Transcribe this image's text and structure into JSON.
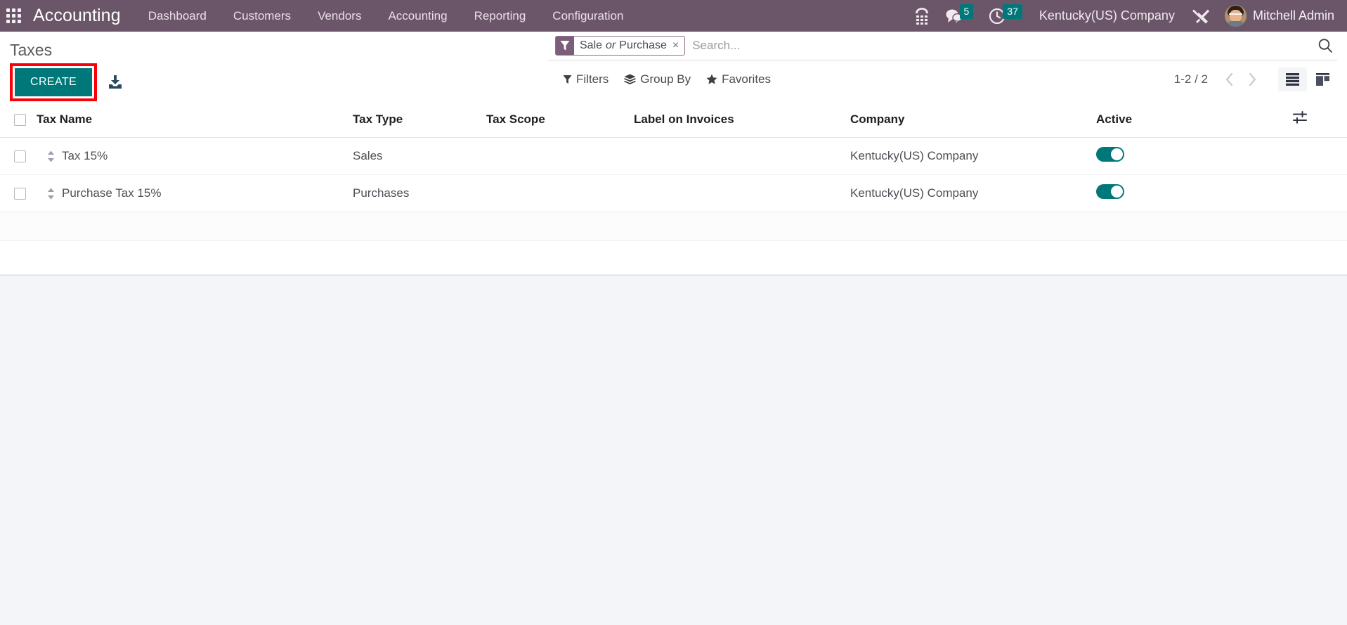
{
  "navbar": {
    "apps_icon": "apps-grid-icon",
    "brand": "Accounting",
    "menu": [
      {
        "label": "Dashboard"
      },
      {
        "label": "Customers"
      },
      {
        "label": "Vendors"
      },
      {
        "label": "Accounting"
      },
      {
        "label": "Reporting"
      },
      {
        "label": "Configuration"
      }
    ],
    "voip_icon": "phone-keypad-icon",
    "messages_icon": "chat-bubble-icon",
    "messages_count": "5",
    "activities_icon": "clock-icon",
    "activities_count": "37",
    "company": "Kentucky(US) Company",
    "tools_icon": "wrench-screwdriver-icon",
    "avatar_icon": "user-avatar",
    "user": "Mitchell Admin",
    "colors": {
      "navbar_bg": "#6b5569",
      "badge_bg": "#00787a"
    }
  },
  "control_panel": {
    "title": "Taxes",
    "create_label": "CREATE",
    "create_color": "#00787a",
    "highlight_color": "#fb0007",
    "import_icon": "import-download-icon",
    "search": {
      "facet_icon": "filter-funnel-icon",
      "facet_part1": "Sale",
      "facet_conj": "or",
      "facet_part2": "Purchase",
      "facet_remove": "×",
      "placeholder": "Search...",
      "value": "",
      "magnifier_icon": "search-icon"
    },
    "tools": [
      {
        "icon": "filter-funnel-icon",
        "label": "Filters"
      },
      {
        "icon": "layers-icon",
        "label": "Group By"
      },
      {
        "icon": "star-icon",
        "label": "Favorites"
      }
    ],
    "pager": {
      "count": "1-2 / 2",
      "prev_icon": "chevron-left-icon",
      "next_icon": "chevron-right-icon"
    },
    "views": [
      {
        "icon": "list-view-icon",
        "active": true
      },
      {
        "icon": "kanban-view-icon",
        "active": false
      }
    ]
  },
  "table": {
    "columns": [
      "Tax Name",
      "Tax Type",
      "Tax Scope",
      "Label on Invoices",
      "Company",
      "Active"
    ],
    "options_icon": "column-options-icon",
    "select_all_icon": "checkbox",
    "rows": [
      {
        "handle_icon": "drag-handle-icon",
        "name": "Tax 15%",
        "type": "Sales",
        "scope": "",
        "label_on_invoices": "",
        "company": "Kentucky(US) Company",
        "active": true
      },
      {
        "handle_icon": "drag-handle-icon",
        "name": "Purchase Tax 15%",
        "type": "Purchases",
        "scope": "",
        "label_on_invoices": "",
        "company": "Kentucky(US) Company",
        "active": true
      }
    ]
  }
}
